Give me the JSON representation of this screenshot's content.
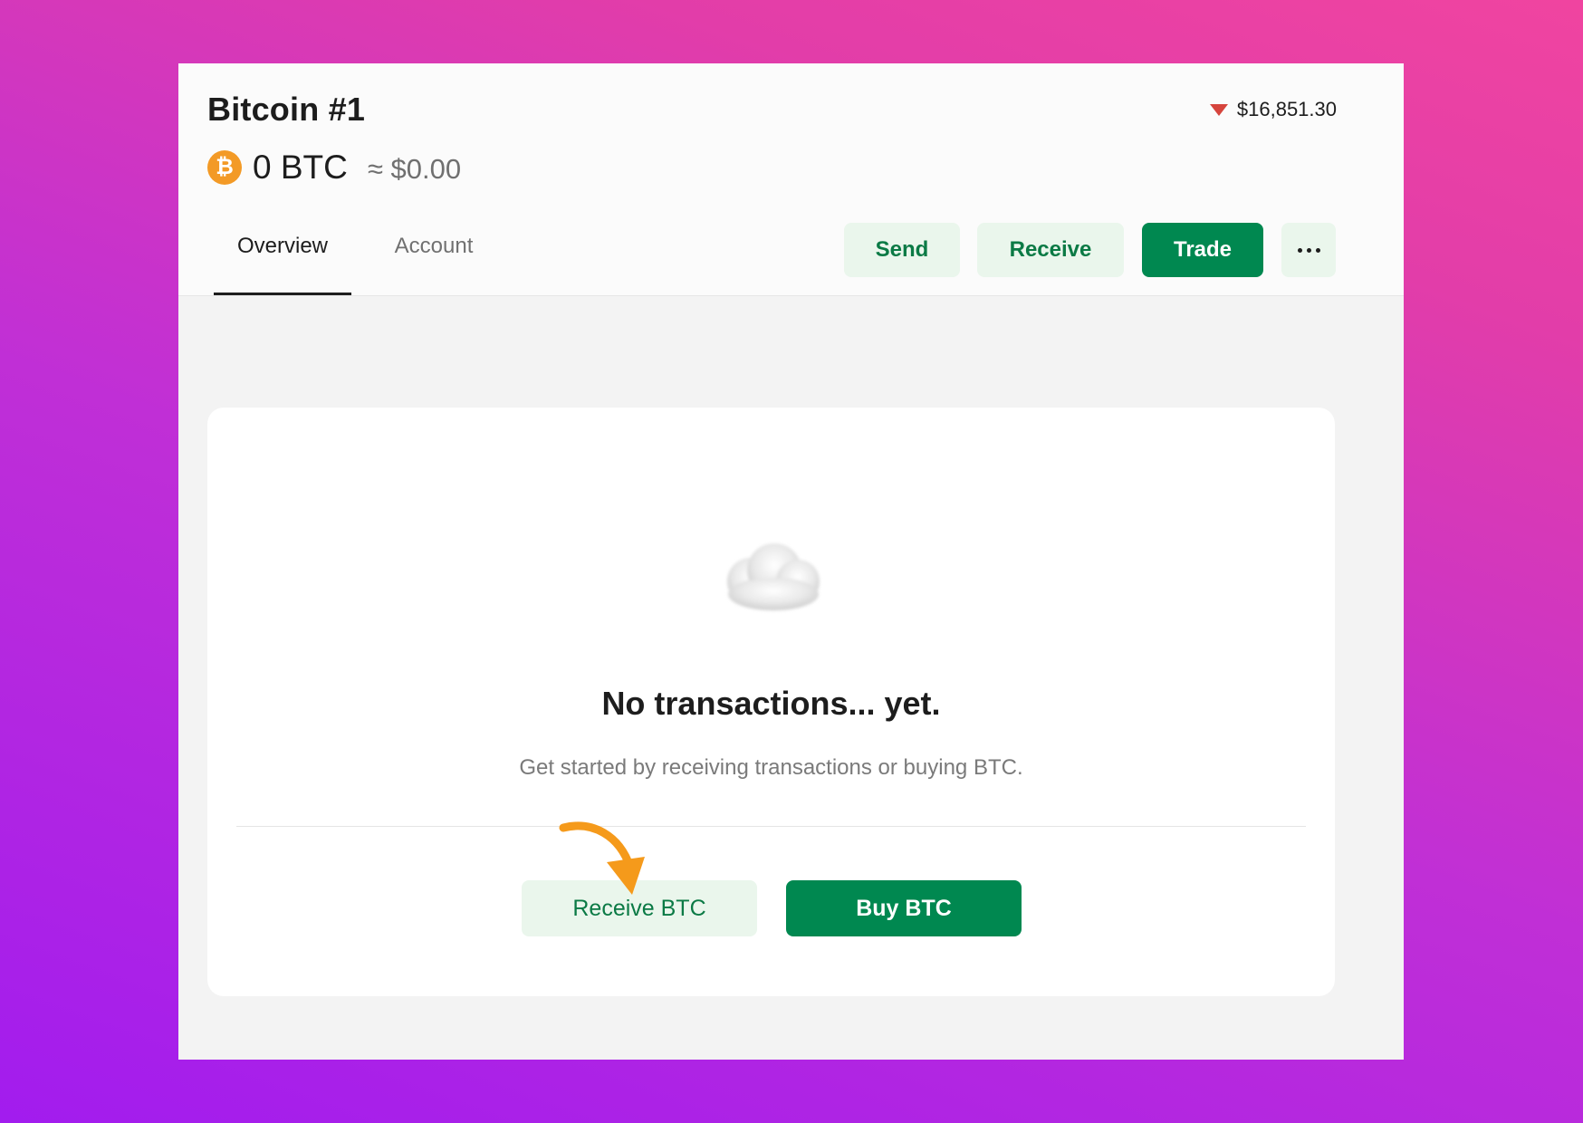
{
  "wallet": {
    "name": "Bitcoin #1",
    "balance_btc": "0 BTC",
    "balance_fiat": "≈ $0.00",
    "coin_symbol": "₿",
    "icon": "bitcoin-icon"
  },
  "price": {
    "value": "$16,851.30",
    "trend": "down",
    "icon": "triangle-down-icon",
    "trend_color": "#d6453d"
  },
  "tabs": [
    {
      "label": "Overview",
      "active": true
    },
    {
      "label": "Account",
      "active": false
    }
  ],
  "actions": {
    "send_label": "Send",
    "receive_label": "Receive",
    "trade_label": "Trade",
    "more_icon": "more-horizontal-icon"
  },
  "empty_state": {
    "illustration": "cloud-icon",
    "title": "No transactions... yet.",
    "subtitle": "Get started by receiving transactions or buying BTC.",
    "receive_label": "Receive BTC",
    "buy_label": "Buy BTC",
    "annotation": "arrow-icon"
  },
  "colors": {
    "accent_green": "#008850",
    "light_green": "#eaf6ec",
    "annotation_orange": "#f59a1b",
    "bitcoin_orange": "#f39a26"
  }
}
